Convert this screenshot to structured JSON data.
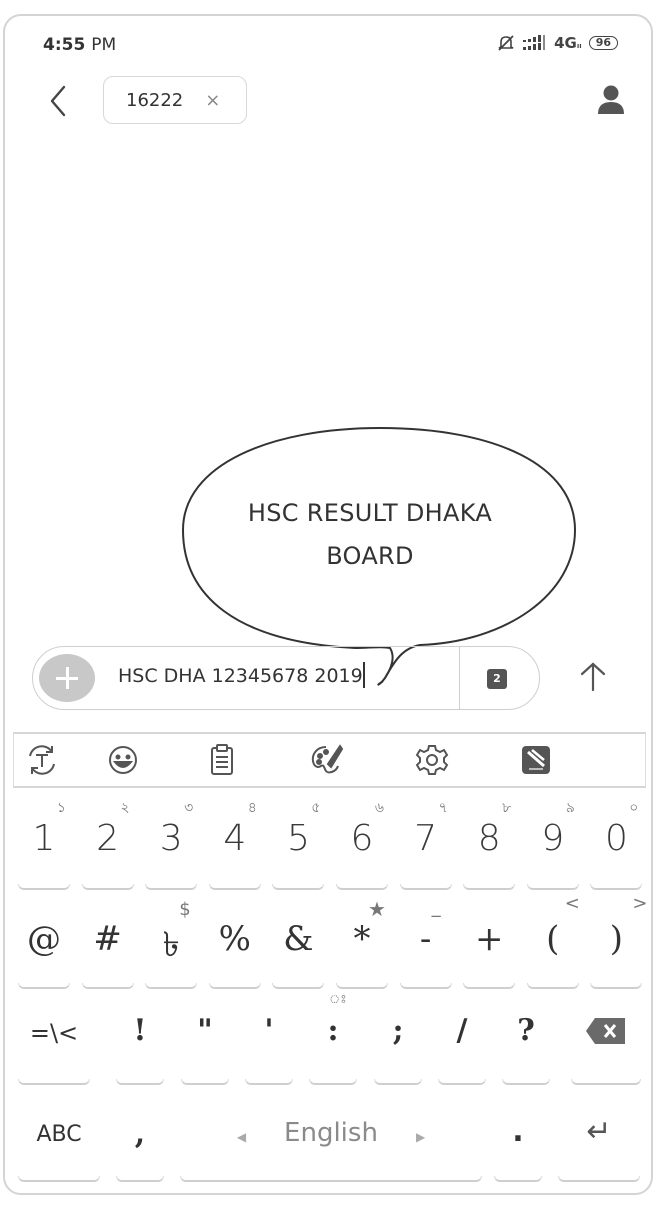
{
  "status_bar": {
    "time": "4:55",
    "ampm": "PM",
    "icons": [
      "mute-bell-icon",
      "signal-icon"
    ],
    "network": "4G",
    "network_sub": "ıı",
    "battery": "96"
  },
  "header": {
    "back_icon": "chevron-left-icon",
    "recipient": "16222",
    "remove_icon": "×",
    "contact_icon": "person-icon"
  },
  "annotation": {
    "bubble_text_line1": "HSC RESULT DHAKA",
    "bubble_text_line2": "BOARD"
  },
  "composer": {
    "add_icon": "plus-icon",
    "message_value": "HSC DHA 12345678 2019",
    "sim_label": "2",
    "send_icon": "arrow-up-icon"
  },
  "keyboard": {
    "toolbar": [
      "transliterate-icon",
      "emoji-icon",
      "clipboard-icon",
      "theme-palette-icon",
      "settings-icon",
      "app-store-icon"
    ],
    "row1": [
      {
        "main": "1",
        "sup": "১"
      },
      {
        "main": "2",
        "sup": "২"
      },
      {
        "main": "3",
        "sup": "৩"
      },
      {
        "main": "4",
        "sup": "৪"
      },
      {
        "main": "5",
        "sup": "৫"
      },
      {
        "main": "6",
        "sup": "৬"
      },
      {
        "main": "7",
        "sup": "৭"
      },
      {
        "main": "8",
        "sup": "৮"
      },
      {
        "main": "9",
        "sup": "৯"
      },
      {
        "main": "0",
        "sup": "০"
      }
    ],
    "row2": [
      {
        "main": "@",
        "sup": ""
      },
      {
        "main": "#",
        "sup": ""
      },
      {
        "main": "৳",
        "sup": "$"
      },
      {
        "main": "%",
        "sup": ""
      },
      {
        "main": "&",
        "sup": ""
      },
      {
        "main": "*",
        "sup": "★"
      },
      {
        "main": "-",
        "sup": "_"
      },
      {
        "main": "+",
        "sup": ""
      },
      {
        "main": "(",
        "sup": "<"
      },
      {
        "main": ")",
        "sup": ">"
      }
    ],
    "row3": [
      {
        "main": "=\\<",
        "sup": ""
      },
      {
        "main": "!",
        "sup": ""
      },
      {
        "main": "\"",
        "sup": ""
      },
      {
        "main": "'",
        "sup": ""
      },
      {
        "main": ":",
        "sup": "ঃ"
      },
      {
        "main": ";",
        "sup": ""
      },
      {
        "main": "/",
        "sup": ""
      },
      {
        "main": "?",
        "sup": ""
      },
      {
        "main": "",
        "sup": "",
        "icon": "backspace-icon"
      }
    ],
    "row4": {
      "abc": "ABC",
      "comma": ",",
      "space": "English",
      "period": ".",
      "enter_icon": "↵"
    }
  }
}
